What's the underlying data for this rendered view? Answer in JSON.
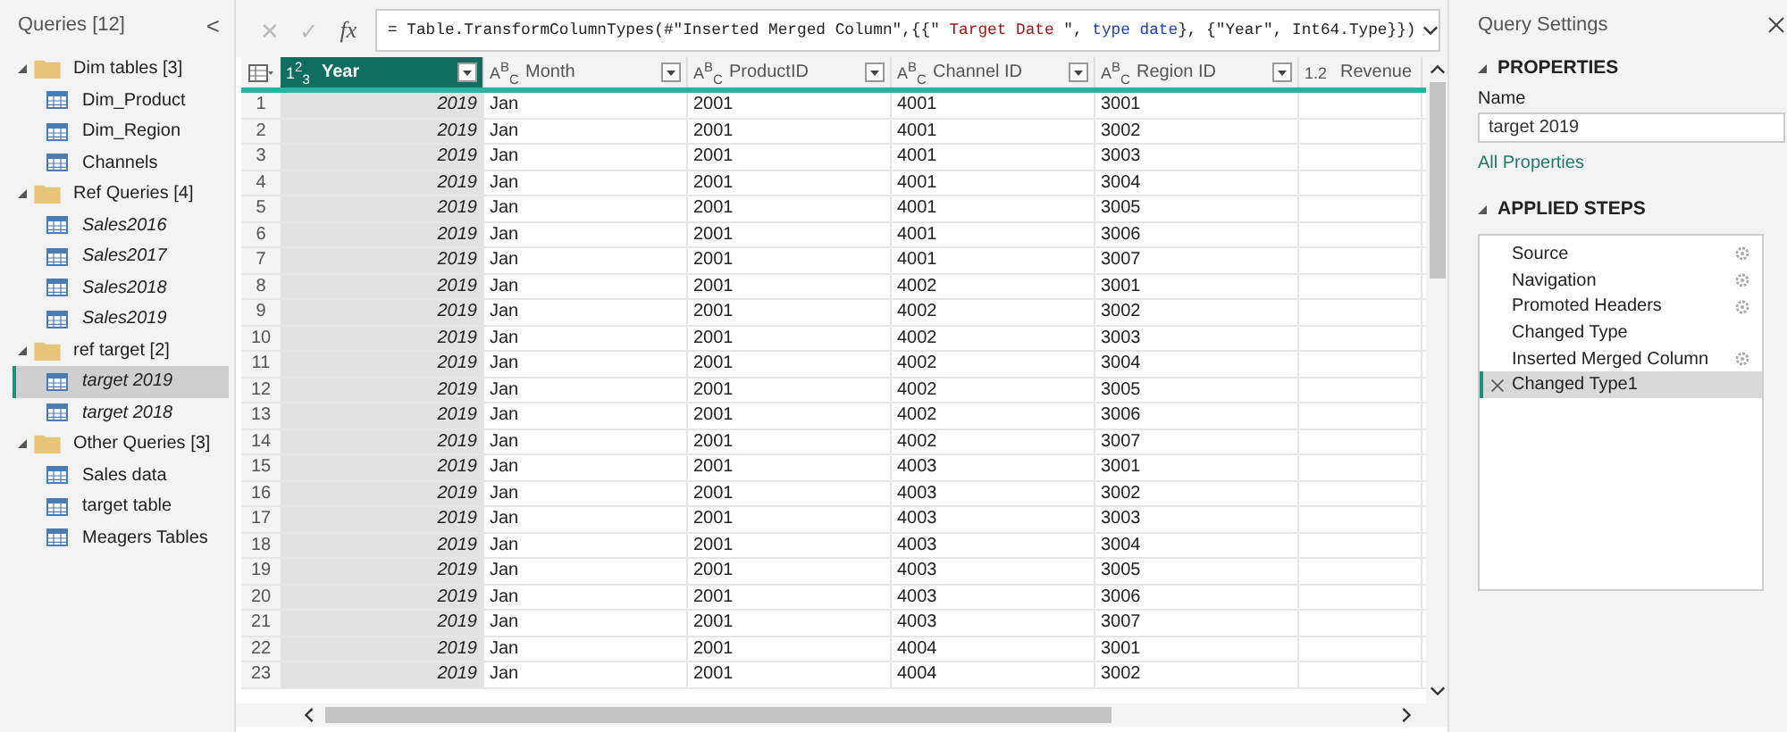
{
  "queries_panel": {
    "title": "Queries [12]",
    "collapse_glyph": "<",
    "groups": [
      {
        "label": "Dim tables [3]",
        "expanded": true,
        "children": [
          {
            "label": "Dim_Product",
            "italic": false,
            "selected": false
          },
          {
            "label": "Dim_Region",
            "italic": false,
            "selected": false
          },
          {
            "label": "Channels",
            "italic": false,
            "selected": false
          }
        ]
      },
      {
        "label": "Ref Queries [4]",
        "expanded": true,
        "children": [
          {
            "label": "Sales2016",
            "italic": true,
            "selected": false
          },
          {
            "label": "Sales2017",
            "italic": true,
            "selected": false
          },
          {
            "label": "Sales2018",
            "italic": true,
            "selected": false
          },
          {
            "label": "Sales2019",
            "italic": true,
            "selected": false
          }
        ]
      },
      {
        "label": "ref target [2]",
        "expanded": true,
        "children": [
          {
            "label": "target 2019",
            "italic": true,
            "selected": true
          },
          {
            "label": "target 2018",
            "italic": true,
            "selected": false
          }
        ]
      },
      {
        "label": "Other Queries [3]",
        "expanded": true,
        "children": [
          {
            "label": "Sales data",
            "italic": false,
            "selected": false
          },
          {
            "label": "target table",
            "italic": false,
            "selected": false
          },
          {
            "label": "Meagers Tables",
            "italic": false,
            "selected": false
          }
        ]
      }
    ]
  },
  "formula_bar": {
    "cancel_glyph": "✕",
    "commit_glyph": "✓",
    "fx": "fx",
    "tokens": [
      {
        "kind": "plain",
        "text": "= Table.TransformColumnTypes(#\"Inserted Merged Column\",{{\""
      },
      {
        "kind": "string",
        "text": " Target Date "
      },
      {
        "kind": "plain",
        "text": "\", "
      },
      {
        "kind": "keyword",
        "text": "type date"
      },
      {
        "kind": "plain",
        "text": "}, {\"Year\", Int64.Type}})"
      }
    ]
  },
  "table": {
    "columns": [
      {
        "name": "Year",
        "type_icon": "1$^{2}$$_{3}$",
        "selected": true
      },
      {
        "name": "Month",
        "type_icon": "A$^{B}$$_{C}$",
        "selected": false
      },
      {
        "name": "ProductID",
        "type_icon": "A$^{B}$$_{C}$",
        "selected": false
      },
      {
        "name": "Channel ID",
        "type_icon": "A$^{B}$$_{C}$",
        "selected": false
      },
      {
        "name": "Region ID",
        "type_icon": "A$^{B}$$_{C}$",
        "selected": false
      },
      {
        "name": "Revenue",
        "type_icon": "1.2",
        "selected": false
      }
    ],
    "rows": [
      {
        "n": "1",
        "cells": [
          "2019",
          "Jan",
          "2001",
          "4001",
          "3001"
        ]
      },
      {
        "n": "2",
        "cells": [
          "2019",
          "Jan",
          "2001",
          "4001",
          "3002"
        ]
      },
      {
        "n": "3",
        "cells": [
          "2019",
          "Jan",
          "2001",
          "4001",
          "3003"
        ]
      },
      {
        "n": "4",
        "cells": [
          "2019",
          "Jan",
          "2001",
          "4001",
          "3004"
        ]
      },
      {
        "n": "5",
        "cells": [
          "2019",
          "Jan",
          "2001",
          "4001",
          "3005"
        ]
      },
      {
        "n": "6",
        "cells": [
          "2019",
          "Jan",
          "2001",
          "4001",
          "3006"
        ]
      },
      {
        "n": "7",
        "cells": [
          "2019",
          "Jan",
          "2001",
          "4001",
          "3007"
        ]
      },
      {
        "n": "8",
        "cells": [
          "2019",
          "Jan",
          "2001",
          "4002",
          "3001"
        ]
      },
      {
        "n": "9",
        "cells": [
          "2019",
          "Jan",
          "2001",
          "4002",
          "3002"
        ]
      },
      {
        "n": "10",
        "cells": [
          "2019",
          "Jan",
          "2001",
          "4002",
          "3003"
        ]
      },
      {
        "n": "11",
        "cells": [
          "2019",
          "Jan",
          "2001",
          "4002",
          "3004"
        ]
      },
      {
        "n": "12",
        "cells": [
          "2019",
          "Jan",
          "2001",
          "4002",
          "3005"
        ]
      },
      {
        "n": "13",
        "cells": [
          "2019",
          "Jan",
          "2001",
          "4002",
          "3006"
        ]
      },
      {
        "n": "14",
        "cells": [
          "2019",
          "Jan",
          "2001",
          "4002",
          "3007"
        ]
      },
      {
        "n": "15",
        "cells": [
          "2019",
          "Jan",
          "2001",
          "4003",
          "3001"
        ]
      },
      {
        "n": "16",
        "cells": [
          "2019",
          "Jan",
          "2001",
          "4003",
          "3002"
        ]
      },
      {
        "n": "17",
        "cells": [
          "2019",
          "Jan",
          "2001",
          "4003",
          "3003"
        ]
      },
      {
        "n": "18",
        "cells": [
          "2019",
          "Jan",
          "2001",
          "4003",
          "3004"
        ]
      },
      {
        "n": "19",
        "cells": [
          "2019",
          "Jan",
          "2001",
          "4003",
          "3005"
        ]
      },
      {
        "n": "20",
        "cells": [
          "2019",
          "Jan",
          "2001",
          "4003",
          "3006"
        ]
      },
      {
        "n": "21",
        "cells": [
          "2019",
          "Jan",
          "2001",
          "4003",
          "3007"
        ]
      },
      {
        "n": "22",
        "cells": [
          "2019",
          "Jan",
          "2001",
          "4004",
          "3001"
        ]
      },
      {
        "n": "23",
        "cells": [
          "2019",
          "Jan",
          "2001",
          "4004",
          "3002"
        ]
      }
    ]
  },
  "settings_panel": {
    "title": "Query Settings",
    "properties": {
      "heading": "PROPERTIES",
      "name_label": "Name",
      "name_value": "target 2019",
      "link": "All Properties"
    },
    "steps_heading": "APPLIED STEPS",
    "steps": [
      {
        "label": "Source",
        "has_settings": true,
        "selected": false
      },
      {
        "label": "Navigation",
        "has_settings": true,
        "selected": false
      },
      {
        "label": "Promoted Headers",
        "has_settings": true,
        "selected": false
      },
      {
        "label": "Changed Type",
        "has_settings": false,
        "selected": false
      },
      {
        "label": "Inserted Merged Column",
        "has_settings": true,
        "selected": false
      },
      {
        "label": "Changed Type1",
        "has_settings": false,
        "selected": true
      }
    ]
  }
}
